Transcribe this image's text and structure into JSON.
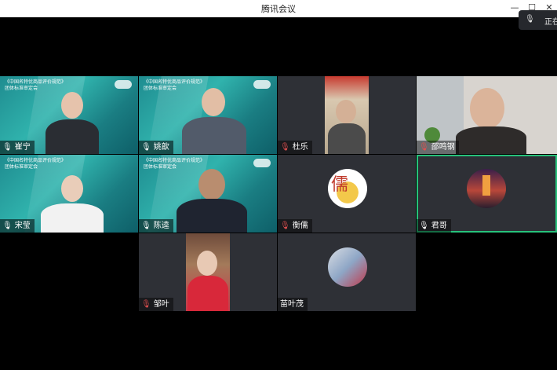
{
  "window": {
    "title": "腾讯会议",
    "speaking_label": "正在"
  },
  "banner_text": {
    "line1": "《中国名特优商品评价规范》",
    "line2": "团体标准审定会"
  },
  "participants": [
    {
      "name": "崔宁"
    },
    {
      "name": "姚歆"
    },
    {
      "name": "杜乐"
    },
    {
      "name": "邵鸣钢"
    },
    {
      "name": "宋莹"
    },
    {
      "name": "陈逵"
    },
    {
      "name": "衡儒"
    },
    {
      "name": "君哥"
    },
    {
      "name": "邹叶"
    },
    {
      "name": "苗叶茂"
    }
  ],
  "colors": {
    "active_border": "#27c27b",
    "tile_bg": "#2e3036",
    "banner_bg": "#2aa6a3"
  }
}
